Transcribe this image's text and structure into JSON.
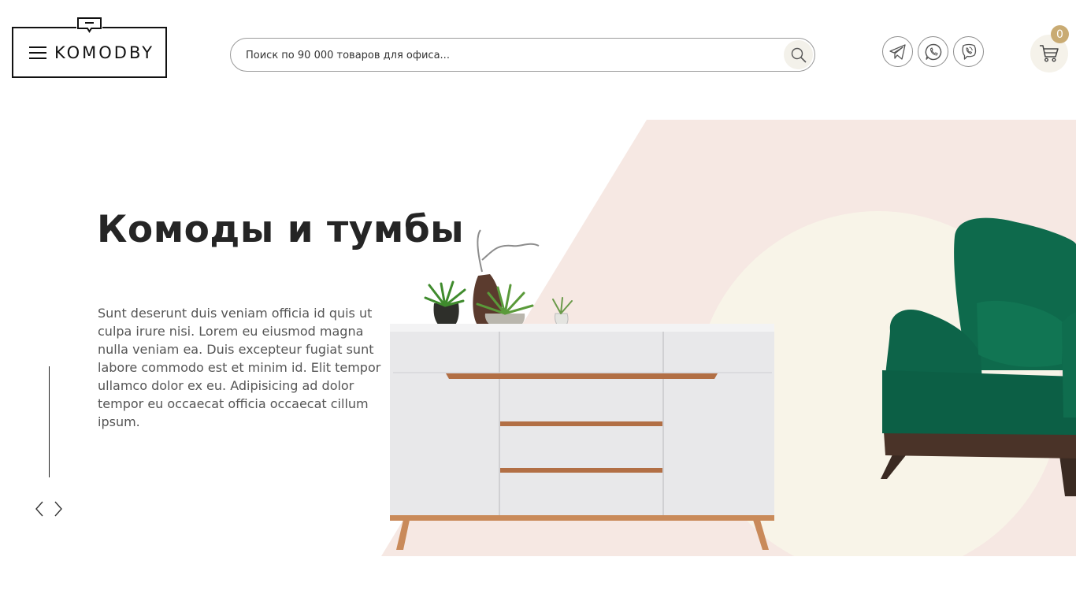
{
  "header": {
    "logo_text": "KOMODBY",
    "search": {
      "placeholder": "Поиск по 90 000 товаров для офиса..."
    },
    "messengers": [
      "telegram-icon",
      "whatsapp-icon",
      "viber-icon"
    ],
    "cart": {
      "count": "0",
      "icon": "cart-icon",
      "badge_color": "#c9ab73"
    }
  },
  "hero": {
    "title": "Комоды и тумбы",
    "text": "Sunt deserunt duis veniam officia id quis ut culpa irure nisi. Lorem eu eiusmod magna nulla veniam ea. Duis excepteur fugiat sunt labore commodo est et minim id. Elit tempor ullamco dolor ex eu. Adipisicing ad dolor tempor eu occaecat officia occaecat cillum ipsum.",
    "nav": {
      "prev_icon": "chevron-left-icon",
      "next_icon": "chevron-right-icon"
    },
    "colors": {
      "pink": "#f6e8e3",
      "cream": "#f8f4e8",
      "armchair": "#0d6b4e"
    }
  }
}
